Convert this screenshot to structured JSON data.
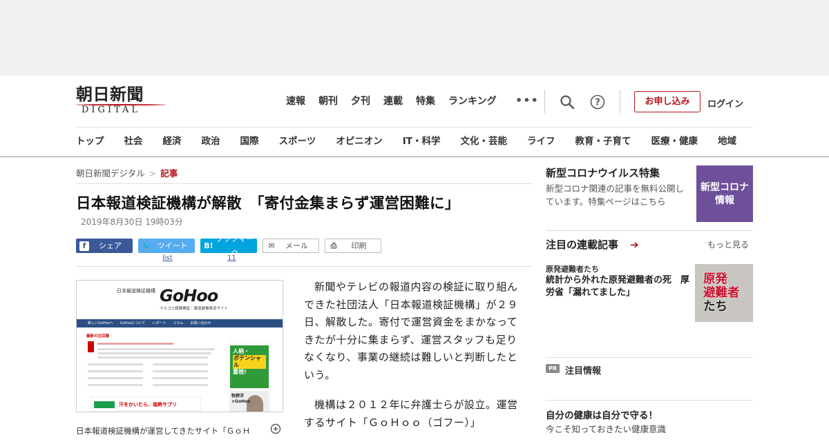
{
  "header": {
    "logo_kanji": "朝日新聞",
    "logo_digital": "DIGITAL",
    "top_nav": [
      "速報",
      "朝刊",
      "夕刊",
      "連載",
      "特集",
      "ランキング"
    ],
    "more_icon": "more-dots-icon",
    "search_icon": "search-icon",
    "help_icon": "help-icon",
    "apply_label": "お申し込み",
    "login_label": "ログイン",
    "category_nav": [
      "トップ",
      "社会",
      "経済",
      "政治",
      "国際",
      "スポーツ",
      "オピニオン",
      "IT・科学",
      "文化・芸能",
      "ライフ",
      "教育・子育て",
      "医療・健康",
      "地域"
    ]
  },
  "breadcrumb": {
    "home": "朝日新聞デジタル",
    "separator": ">",
    "current": "記事"
  },
  "article": {
    "headline": "日本報道検証機構が解散　「寄付金集まらず運営困難に」",
    "date": "2019年8月30日 19時03分",
    "share": {
      "facebook": "シェア",
      "twitter": "ツイート",
      "twitter_count": "list",
      "hatena": "ブックマーク",
      "hatena_count": "11",
      "mail": "メール",
      "print": "印刷"
    },
    "image": {
      "site_title": "日本報道検証機構",
      "brand": "GoHoo",
      "brand_sub": "マスコミ誤報検証・報道被害救済サイト",
      "nav_text": "新しいGoHooへ　　GoHooについて　　レポート　　コラム　　お問い合わせ",
      "latest_label": "最新の注目報",
      "ad_text_a": "人柄・",
      "ad_text_b": "ポテンシャル",
      "ad_text_c": "重視!",
      "ad2_text": "牧野洋×GoHoo",
      "bottom_ad": "汗をかいたら、塩熱サプリ",
      "caption": "日本報道検証機構が運営してきたサイト「ＧｏＨ"
    },
    "paragraphs": [
      "新聞やテレビの報道内容の検証に取り組んできた社団法人「日本報道検証機構」が２９日、解散した。寄付で運営資金をまかなってきたが十分に集まらず、運営スタッフも足りなくなり、事業の継続は難しいと判断したという。",
      "機構は２０１２年に弁護士らが設立。運営するサイト「ＧｏＨｏｏ（ゴフー）」"
    ]
  },
  "sidebar": {
    "covid_title": "新型コロナウイルス特集",
    "covid_desc": "新型コロナ関連の記事を無料公開しています。特集ページはこちら",
    "covid_box": [
      "新型コロナ",
      "情報"
    ],
    "rensai_title": "注目の連載記事",
    "rensai_more": "もっと見る",
    "series_name": "原発避難者たち",
    "series_article": "統計から外れた原発避難者の死　厚労省「漏れてました」",
    "series_image_text": [
      "原発",
      "避難者",
      "たち"
    ],
    "pr_badge": "PR",
    "pr_label": "注目情報",
    "health_title": "自分の健康は自分で守る！",
    "health_sub": "今こそ知っておきたい健康意識"
  },
  "colors": {
    "brand_red": "#b5121b",
    "facebook": "#3b5998",
    "twitter": "#55acee",
    "hatena": "#00a4de",
    "covid_purple": "#6d4f9a"
  }
}
